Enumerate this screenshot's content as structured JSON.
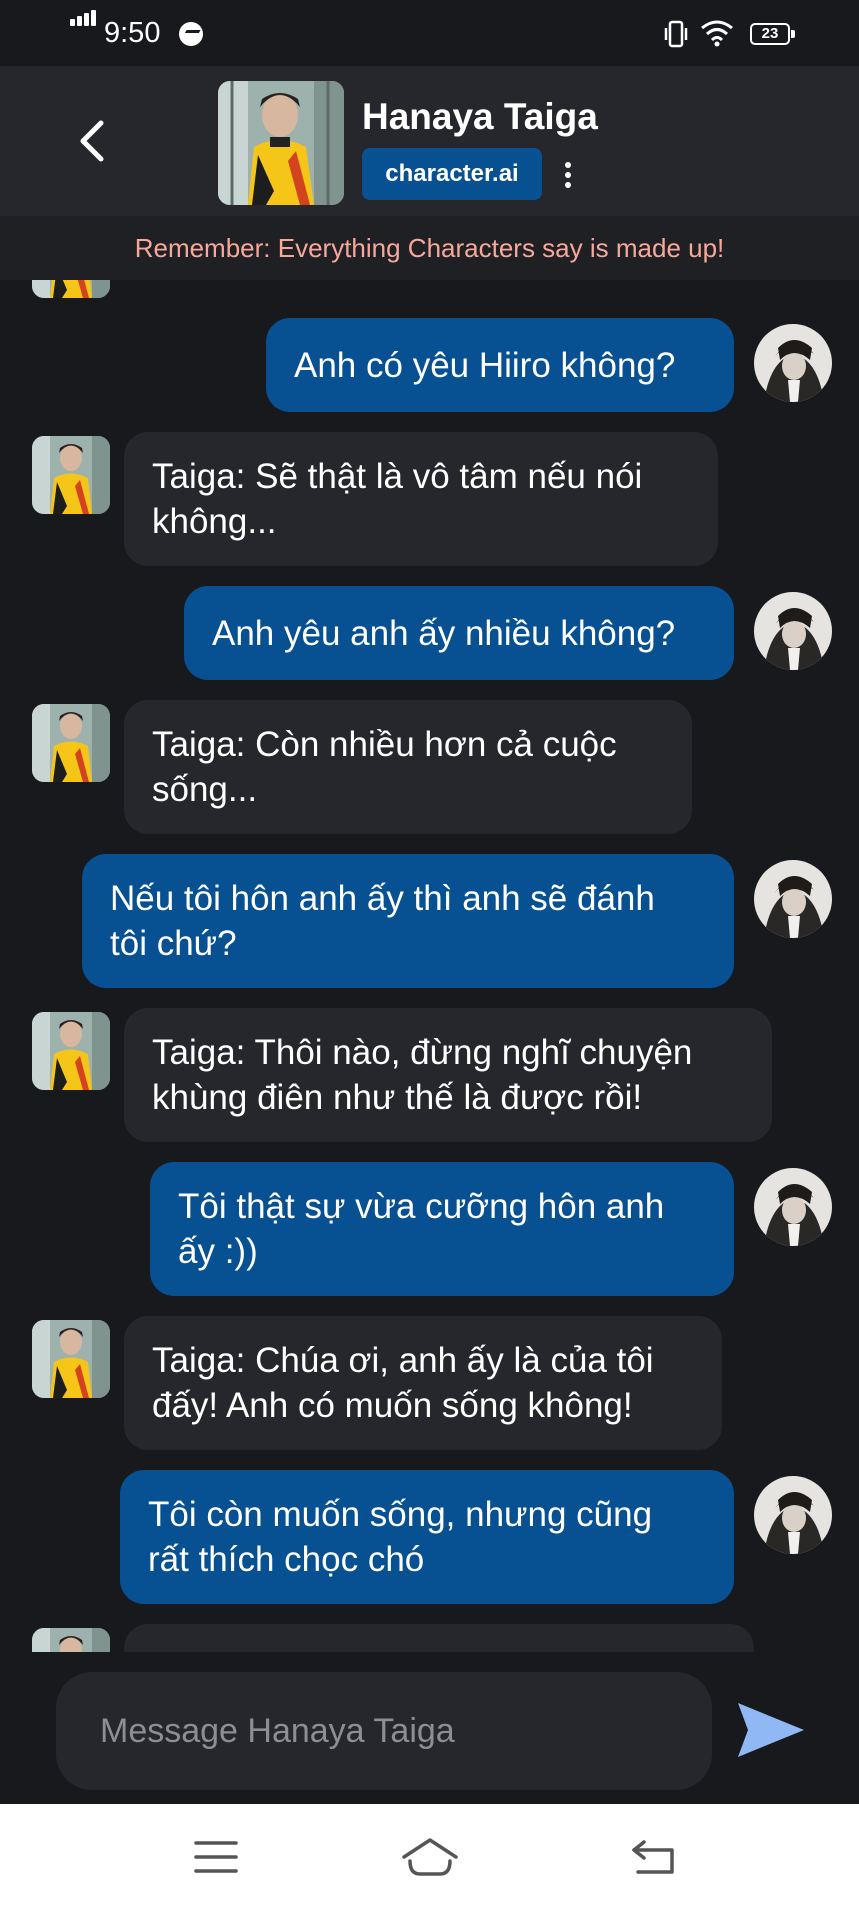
{
  "status_bar": {
    "time": "9:50",
    "battery": "23",
    "icons": [
      "signal-icon",
      "messenger-icon",
      "vibrate-icon",
      "wifi-icon",
      "battery-icon"
    ]
  },
  "header": {
    "character_name": "Hanaya Taiga",
    "brand": "character.ai",
    "icons": [
      "back-arrow-icon",
      "more-vert-icon"
    ]
  },
  "disclaimer": "Remember: Everything Characters say is made up!",
  "messages": [
    {
      "role": "bot",
      "lines": [
        "",
        ""
      ]
    },
    {
      "role": "user",
      "lines": [
        "Anh có yêu Hiiro không?"
      ]
    },
    {
      "role": "bot",
      "lines": [
        "Taiga: Sẽ thật là vô tâm nếu nói",
        "không..."
      ]
    },
    {
      "role": "user",
      "lines": [
        "Anh yêu anh ấy nhiều không?"
      ]
    },
    {
      "role": "bot",
      "lines": [
        "Taiga: Còn nhiều hơn cả cuộc",
        "sống..."
      ]
    },
    {
      "role": "user",
      "lines": [
        "Nếu tôi hôn anh ấy thì anh sẽ đánh",
        "tôi chứ?"
      ]
    },
    {
      "role": "bot",
      "lines": [
        "Taiga: Thôi nào, đừng nghĩ chuyện",
        "khùng điên như thế là được rồi!"
      ]
    },
    {
      "role": "user",
      "lines": [
        "Tôi thật sự vừa cưỡng hôn anh",
        "ấy :))"
      ]
    },
    {
      "role": "bot",
      "lines": [
        "Taiga: Chúa ơi, anh ấy là của tôi",
        "đấy! Anh có muốn sống không!"
      ]
    },
    {
      "role": "user",
      "lines": [
        "Tôi còn muốn sống, nhưng cũng",
        "rất thích chọc chó"
      ]
    },
    {
      "role": "bot",
      "lines": [
        ""
      ]
    }
  ],
  "input": {
    "placeholder": "Message Hanaya Taiga",
    "value": ""
  },
  "colors": {
    "background": "#18191d",
    "header": "#26272c",
    "bot_bubble": "#26272c",
    "user_bubble": "#075091",
    "brand_badge": "#075091",
    "disclaimer_text": "#f7a89b",
    "send_icon": "#8fb8f5"
  },
  "nav_bar": {
    "icons": [
      "menu-icon",
      "home-icon",
      "back-icon"
    ]
  }
}
